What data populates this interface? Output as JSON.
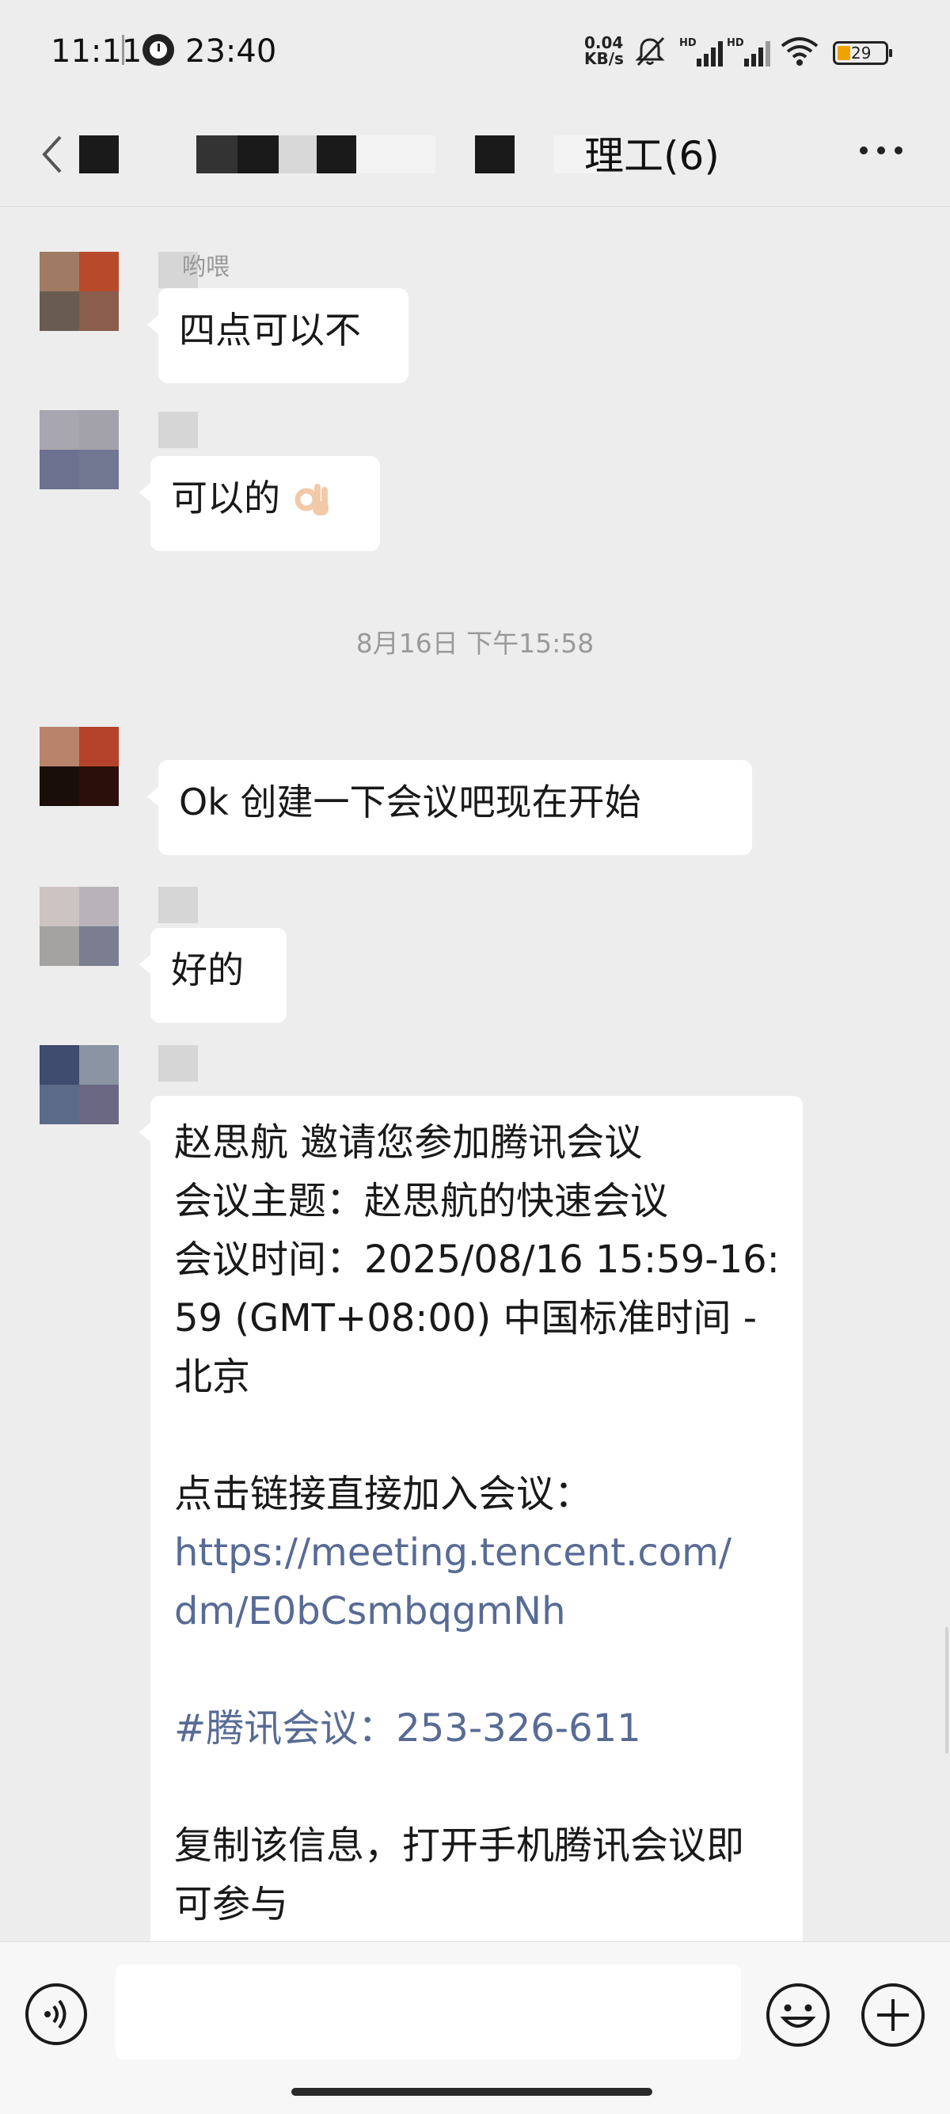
{
  "status_bar": {
    "time": "11:11",
    "alarm_time": "23:40",
    "net_speed_value": "0.04",
    "net_speed_unit": "KB/s",
    "signal_tag": "HD",
    "battery_level": "29",
    "icons": [
      "clock-icon",
      "mute-bell-icon",
      "signal-icon",
      "wifi-icon",
      "battery-icon"
    ]
  },
  "header": {
    "title_visible": "理工(6)",
    "more_label": "···"
  },
  "messages": [
    {
      "sender_name": "哟喂",
      "text": "四点可以不"
    },
    {
      "sender_name": "",
      "text": "可以的",
      "emoji": "ok-hand-icon"
    },
    {
      "sender_name": "",
      "text": "Ok  创建一下会议吧现在开始"
    },
    {
      "sender_name": "",
      "text": "好的"
    }
  ],
  "timestamp": "8月16日 下午15:58",
  "invite": {
    "lines": [
      "赵思航 邀请您参加腾讯会议",
      "会议主题：赵思航的快速会议",
      "会议时间：2025/08/16 15:59-16:",
      "59 (GMT+08:00) 中国标准时间 -",
      "北京"
    ],
    "join_prompt": "点击链接直接加入会议：",
    "link_line1": "https://meeting.tencent.com/",
    "link_line2": "dm/E0bCsmbqgmNh",
    "meeting_id": "#腾讯会议：253-326-611",
    "footer_line1": "复制该信息，打开手机腾讯会议即",
    "footer_line2": "可参与"
  },
  "input_bar": {
    "placeholder": "",
    "icons": [
      "voice-icon",
      "emoji-icon",
      "plus-icon"
    ]
  },
  "colors": {
    "background": "#ededed",
    "bubble": "#ffffff",
    "link": "#576b95",
    "timestamp": "#9a9a9a"
  }
}
